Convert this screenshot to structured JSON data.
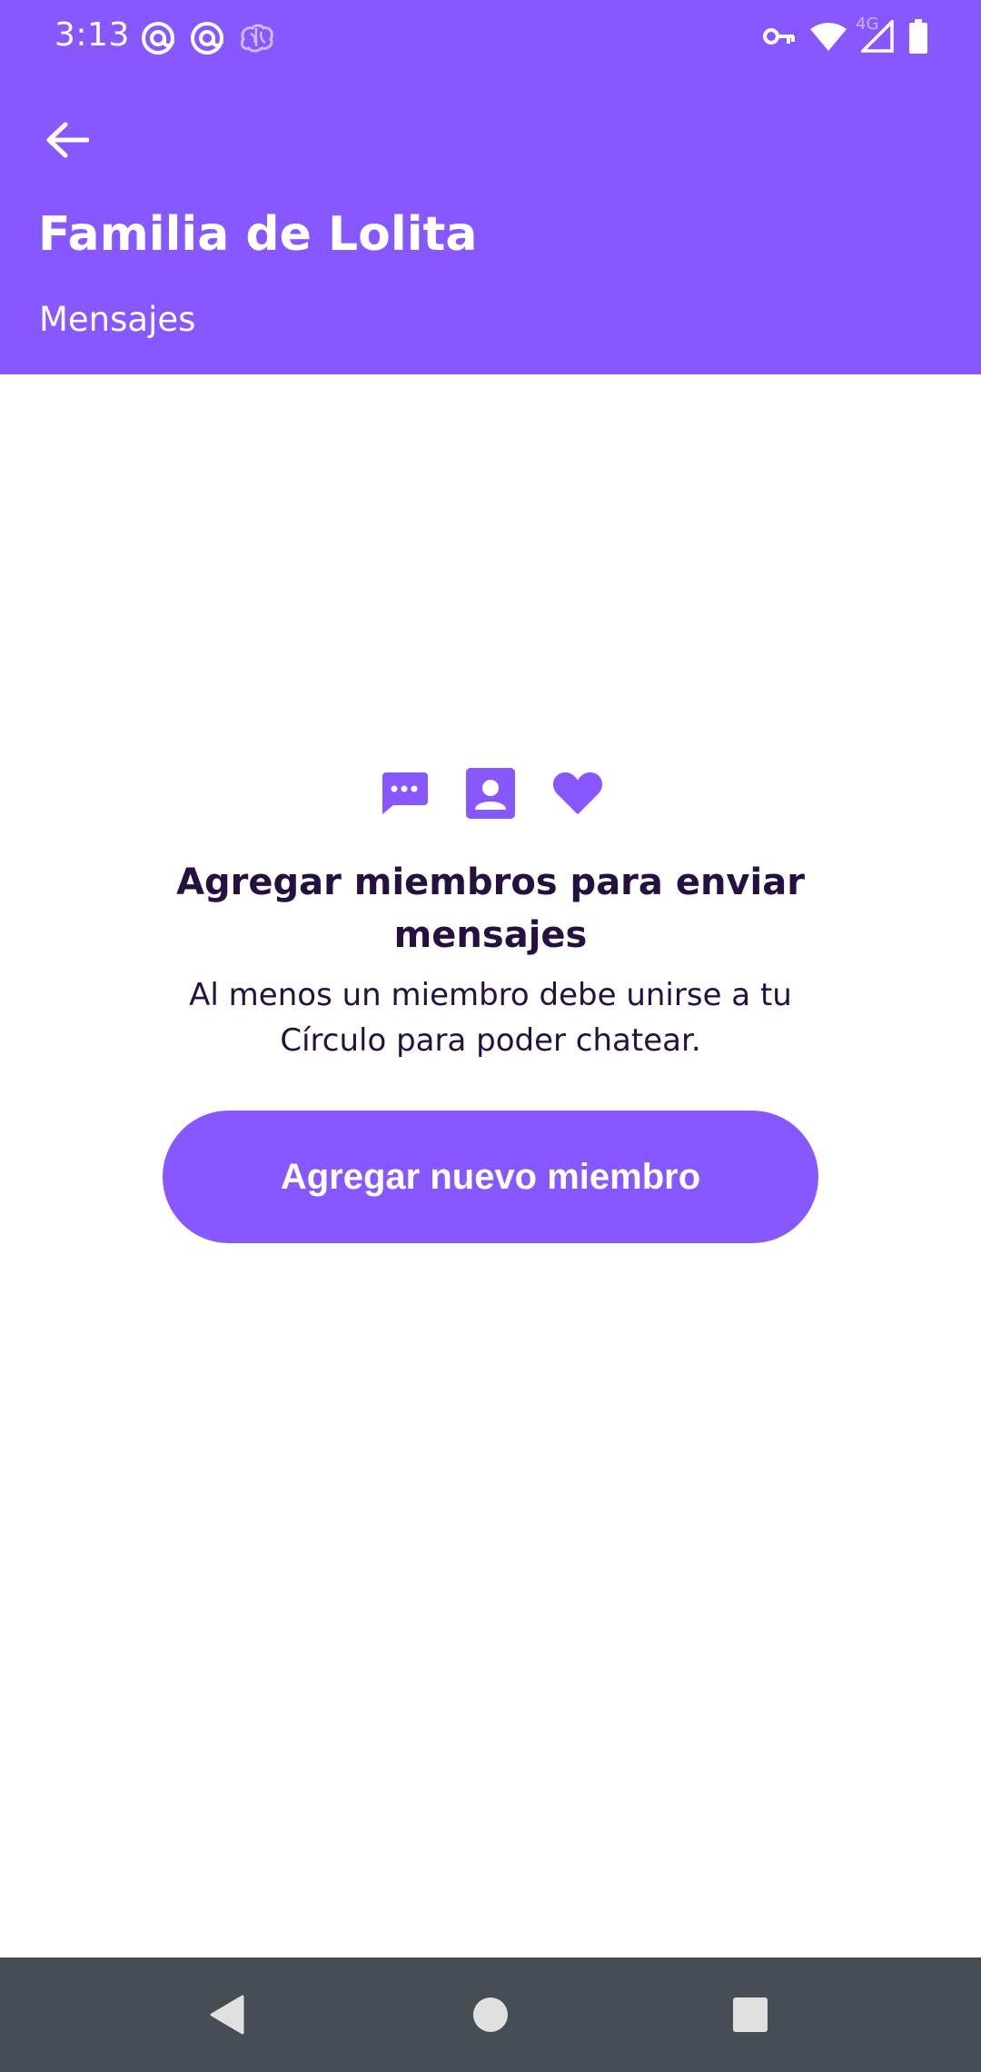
{
  "status_bar": {
    "time": "3:13",
    "left_icons": [
      "at-sign-icon",
      "at-sign-icon",
      "brain-icon"
    ],
    "right_icons": [
      "vpn-key-icon",
      "wifi-icon",
      "cellular-signal-icon",
      "battery-icon"
    ],
    "network_type": "4G"
  },
  "app_bar": {
    "back_icon": "arrow-left-icon",
    "title": "Familia de Lolita",
    "subtitle": "Mensajes"
  },
  "empty_state": {
    "icons": [
      "chat-bubble-icon",
      "contact-card-icon",
      "heart-icon"
    ],
    "title": "Agregar miembros para enviar mensajes",
    "description": "Al menos un miembro debe unirse a tu Círculo para poder chatear.",
    "button_label": "Agregar nuevo miembro"
  },
  "nav_bar": {
    "buttons": [
      "back-triangle-icon",
      "home-circle-icon",
      "recents-square-icon"
    ]
  },
  "colors": {
    "primary": "#8757FF",
    "text_dark": "#26103F",
    "nav_bar": "#464D54",
    "background": "#FFFFFF"
  }
}
